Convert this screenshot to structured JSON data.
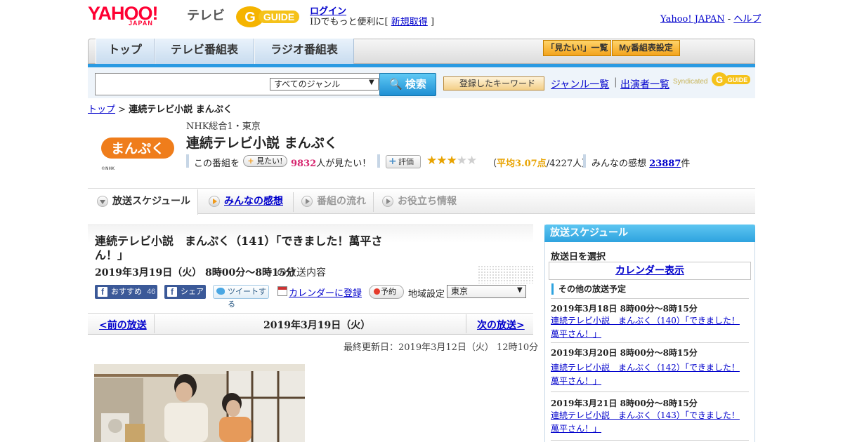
{
  "header": {
    "yahoo_logo": "YAHOO!",
    "yahoo_logo_sub": "JAPAN",
    "tv_label": "テレビ",
    "gguide_logo": "G-GUIDE",
    "login": "ログイン",
    "promo_prefix": "IDでもっと便利に[",
    "signup": "新規取得",
    "promo_suffix": "]",
    "yahoo_japan_link": "Yahoo! JAPAN",
    "separator": "-",
    "help_link": "ヘルプ"
  },
  "nav": {
    "tabs": [
      "トップ",
      "テレビ番組表",
      "ラジオ番組表"
    ],
    "mitai_list": "「見たい!」一覧",
    "my_schedule": "My番組表設定"
  },
  "search": {
    "genre_selected": "すべてのジャンル",
    "button": "検索",
    "keyword_button": "登録したキーワード",
    "genre_list": "ジャンル一覧",
    "separator": "|",
    "performer_list": "出演者一覧",
    "syndicated": "Syndicated"
  },
  "breadcrumb": {
    "top": "トップ",
    "sep": ">",
    "current": "連続テレビ小説 まんぷく"
  },
  "program": {
    "logo_text": "まんぷく",
    "logo_copyright": "©NHK",
    "channel": "NHK総合1・東京",
    "title": "連続テレビ小説 まんぷく",
    "mitai_prefix": "この番組を",
    "mitai_button": "見たい!",
    "mitai_count": "9832",
    "mitai_suffix": "人が見たい！",
    "rating_button": "評価",
    "rating": 3.07,
    "rating_open": "（",
    "rating_label": "平均3.07点",
    "rating_people": "/4227人）",
    "kansou_label": "みんなの感想",
    "kansou_count": "23887",
    "kansou_unit": "件"
  },
  "tabs": {
    "schedule": "放送スケジュール",
    "reviews": "みんなの感想",
    "flow": "番組の流れ",
    "info": "お役立ち情報"
  },
  "episode": {
    "title": "連続テレビ小説　まんぷく（141）「できました！萬平さん！」",
    "date": "2019年3月19日（火） 8時00分～8時15分",
    "date_suffix": "の放送内容",
    "fb_recommend": "おすすめ",
    "fb_count": "46",
    "fb_share": "シェア",
    "tweet": "ツイートする",
    "calendar_register": "カレンダーに登録",
    "reserve": "予約",
    "region_label": "地域設定",
    "region_value": "東京",
    "prev": "<前の放送",
    "current_date": "2019年3月19日（火）",
    "next": "次の放送>",
    "updated": "最終更新日：2019年3月12日（火） 12時10分"
  },
  "sidebar": {
    "header": "放送スケジュール",
    "select_date": "放送日を選択",
    "calendar_button": "カレンダー表示",
    "other_schedule": "その他の放送予定",
    "items": [
      {
        "date": "2019年3月18日 8時00分～8時15分",
        "title": "連続テレビ小説　まんぷく（140）「できました！萬平さん！」"
      },
      {
        "date": "2019年3月20日 8時00分～8時15分",
        "title": "連続テレビ小説　まんぷく（142）「できました！萬平さん！」"
      },
      {
        "date": "2019年3月21日 8時00分～8時15分",
        "title": "連続テレビ小説　まんぷく（143）「できました！萬平さん！」"
      }
    ]
  },
  "colors": {
    "accent_blue": "#2a9ae2",
    "link": "#0000cc",
    "count_pink": "#d6246e",
    "star_gold": "#e8a300"
  }
}
